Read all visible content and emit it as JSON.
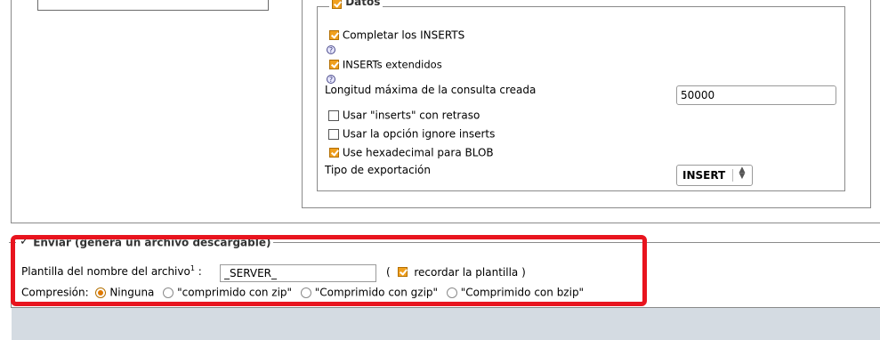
{
  "datos": {
    "legend": "Datos",
    "completar_inserts": "Completar los INSERTS",
    "inserts_extendidos": "INSERTs extendidos",
    "help_glyph": "?",
    "longitud_label": "Longitud máxima de la consulta creada",
    "longitud_value": "50000",
    "usar_retraso": "Usar \"inserts\" con retraso",
    "usar_ignore": "Usar la opción ignore inserts",
    "use_hex_blob": "Use hexadecimal para BLOB",
    "tipo_label": "Tipo de exportación",
    "tipo_value": "INSERT"
  },
  "enviar": {
    "legend": "Enviar (genera un archivo descargable)",
    "plantilla_label": "Plantilla del nombre del archivo",
    "plantilla_sup": "1",
    "plantilla_colon": " :",
    "plantilla_value": "_SERVER_",
    "paren_open": "(",
    "recordar_label": "recordar la plantilla )",
    "compresion_label": "Compresión:",
    "options": [
      "Ninguna",
      "\"comprimido con zip\"",
      "\"Comprimido con gzip\"",
      "\"Comprimido con bzip\""
    ],
    "selected_option": "Ninguna"
  },
  "colors": {
    "highlight": "#e8141e",
    "checkbox_checked": "#f0a01e",
    "footer_bg": "#d4dbe2"
  }
}
